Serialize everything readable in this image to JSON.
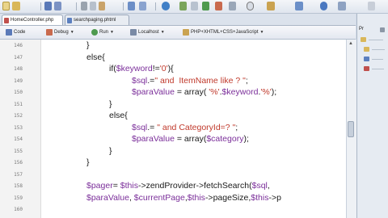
{
  "tabs": [
    {
      "label": "HomeController.php",
      "active": true
    },
    {
      "label": "searchpaging.phtml",
      "active": false
    }
  ],
  "editor_toolbar": {
    "code_label": "Code",
    "debug_label": "Debug",
    "run_label": "Run",
    "server_label": "Localhost",
    "language_label": "PHP+XHTML+CSS+JavaScript"
  },
  "right_panel": {
    "title": "Pr"
  },
  "line_numbers": [
    "146",
    "147",
    "148",
    "149",
    "150",
    "151",
    "152",
    "153",
    "154",
    "155",
    "156",
    "157",
    "158",
    "159",
    "160"
  ],
  "code_lines": [
    [
      "",
      "}"
    ],
    [
      "",
      "else{"
    ],
    [
      "",
      "if($keyword!='0'){"
    ],
    [
      "",
      "$sql.=\" and  ItemName like ? \";"
    ],
    [
      "",
      "$paraValue = array( '%'.$keyword.'%');"
    ],
    [
      "",
      "}"
    ],
    [
      "",
      "else{"
    ],
    [
      "",
      "$sql.= \" and CategoryId=? \";"
    ],
    [
      "",
      "$paraValue = array($category);"
    ],
    [
      "",
      "}"
    ],
    [
      "",
      "}"
    ],
    [
      "",
      ""
    ],
    [
      "",
      "$pager= $this->zendProvider->fetchSearch($sql,"
    ],
    [
      "",
      "$paraValue, $currentPage,$this->pageSize,$this->p"
    ],
    [
      "",
      ""
    ]
  ],
  "colors": {
    "variable": "#7b2f9a",
    "string": "#c0392b",
    "text": "#1a1a1a"
  }
}
